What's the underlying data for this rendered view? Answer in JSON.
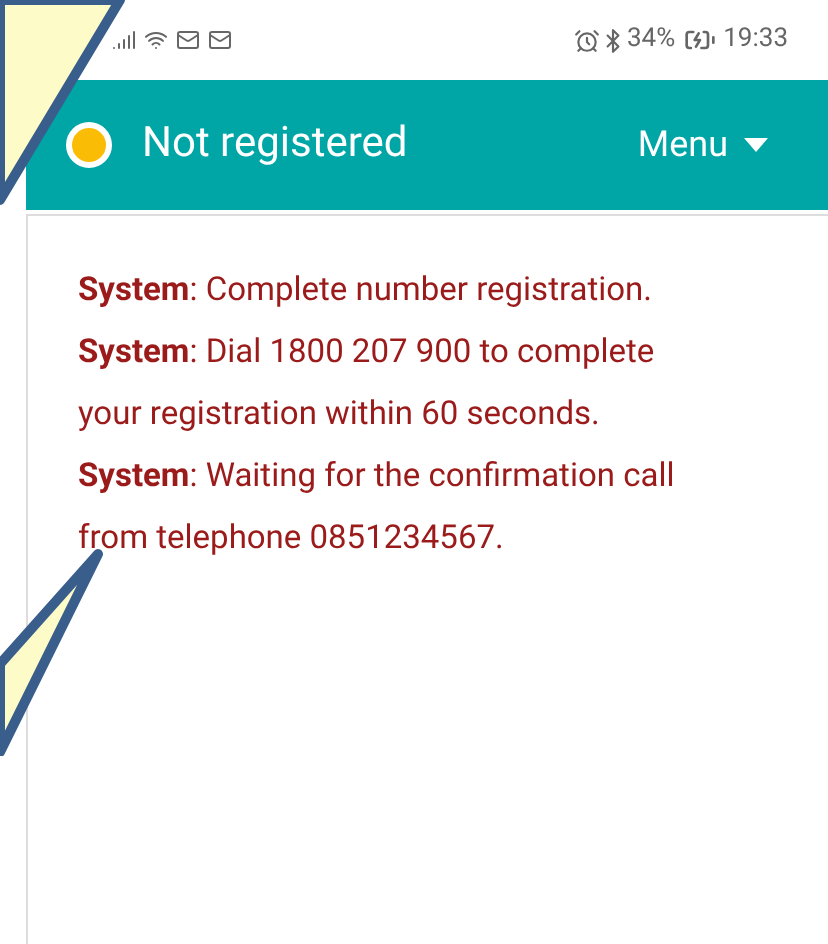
{
  "status_bar": {
    "battery": "34%",
    "time": "19:33"
  },
  "header": {
    "registered": false,
    "title": "Not registered",
    "menu": "Menu"
  },
  "messages": [
    "**System**: Complete number registration.",
    "**System**: Dial 1800 207 900 to complete your registration within 60 seconds.",
    "**System**: Waiting for the confirmation call from telephone 0851234567."
  ]
}
